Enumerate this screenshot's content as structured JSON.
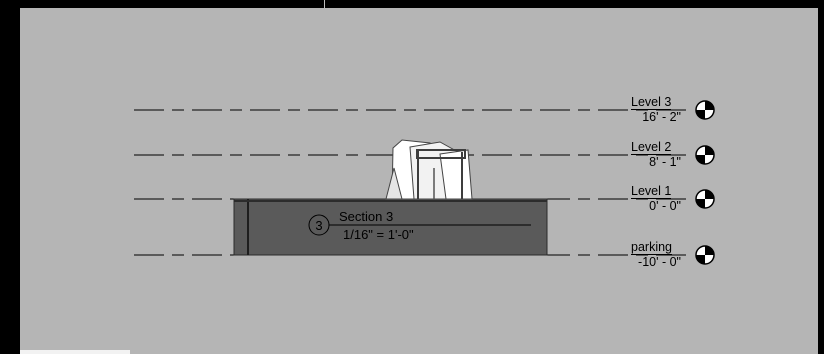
{
  "levels": [
    {
      "name": "Level 3",
      "elevation": "16' - 2\""
    },
    {
      "name": "Level 2",
      "elevation": "8' - 1\""
    },
    {
      "name": "Level 1",
      "elevation": "0' - 0\""
    },
    {
      "name": "parking",
      "elevation": "-10' - 0\""
    }
  ],
  "section_callout": {
    "number": "3",
    "title": "Section 3",
    "scale": "1/16\" = 1'-0\""
  },
  "colors": {
    "canvas_background": "#b5b5b5",
    "level_line": "#000000",
    "section_mass": "#5a5a5a"
  }
}
